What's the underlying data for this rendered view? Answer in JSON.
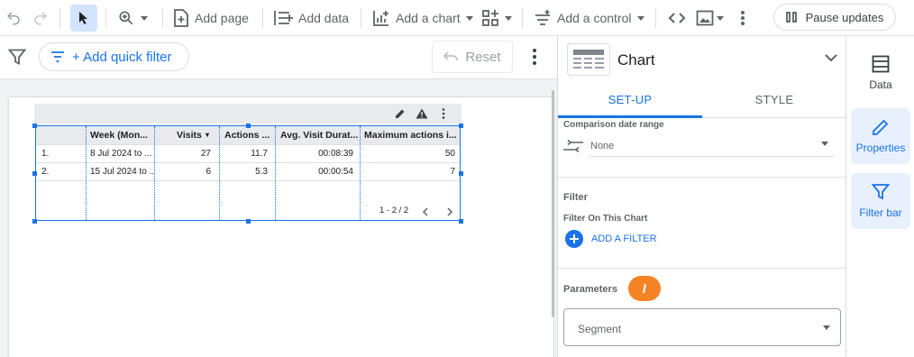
{
  "toolbar": {
    "add_page": "Add page",
    "add_data": "Add data",
    "add_chart": "Add a chart",
    "add_control": "Add a control",
    "pause_updates": "Pause updates"
  },
  "filter_bar": {
    "add_quick_filter": "+ Add quick filter",
    "reset": "Reset"
  },
  "table": {
    "headers": [
      "Week (Mon...",
      "Visits",
      "Actions ...",
      "Avg. Visit Durat...",
      "Maximum actions i..."
    ],
    "sort_indicator": "▾",
    "rows": [
      {
        "index": "1.",
        "week": "8 Jul 2024 to ...",
        "visits": "27",
        "actions": "11.7",
        "avg_duration": "00:08:39",
        "max_actions": "50"
      },
      {
        "index": "2.",
        "week": "15 Jul 2024 to ...",
        "visits": "6",
        "actions": "5.3",
        "avg_duration": "00:00:54",
        "max_actions": "7"
      }
    ],
    "pagination": "1 - 2 / 2"
  },
  "properties": {
    "title": "Chart",
    "tab_setup": "SET-UP",
    "tab_style": "STYLE",
    "comparison_label": "Comparison date range",
    "comparison_value": "None",
    "filter_title": "Filter",
    "filter_on_chart": "Filter On This Chart",
    "add_filter": "ADD A FILTER",
    "parameters_title": "Parameters",
    "segment_value": "Segment"
  },
  "rail": {
    "data": "Data",
    "properties": "Properties",
    "filter_bar": "Filter bar"
  },
  "colors": {
    "accent": "#1a73e8",
    "active_bg": "#e8f0fe",
    "cursor_marker": "#f58426"
  }
}
